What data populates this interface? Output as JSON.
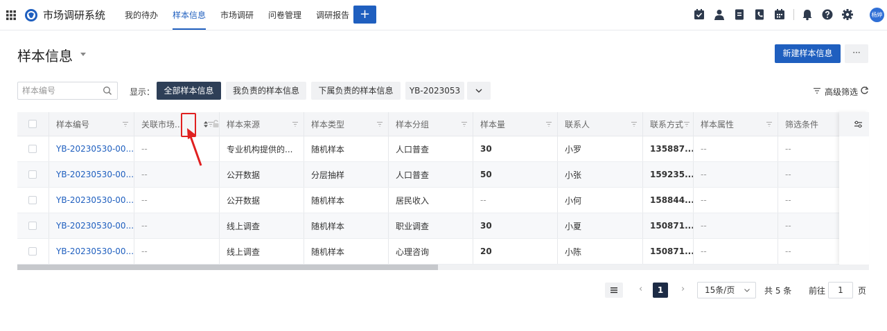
{
  "app": {
    "title": "市场调研系统"
  },
  "nav": {
    "items": [
      {
        "label": "我的待办",
        "active": false
      },
      {
        "label": "样本信息",
        "active": true
      },
      {
        "label": "市场调研",
        "active": false
      },
      {
        "label": "问卷管理",
        "active": false
      },
      {
        "label": "调研报告",
        "active": false
      }
    ],
    "plus_label": "+"
  },
  "toolbar": {
    "icons": [
      "check-square-icon",
      "user-icon",
      "document-icon",
      "phone-book-icon",
      "calendar-icon",
      "bell-icon",
      "help-icon",
      "gear-icon"
    ],
    "avatar_text": "杨婷"
  },
  "page": {
    "title": "样本信息",
    "new_button": "新建样本信息",
    "more_button": "···"
  },
  "filters": {
    "search_placeholder": "样本编号",
    "show_label": "显示：",
    "chips": [
      {
        "label": "全部样本信息",
        "active": true
      },
      {
        "label": "我负责的样本信息",
        "active": false
      },
      {
        "label": "下属负责的样本信息",
        "active": false
      },
      {
        "label": "YB-2023053",
        "active": false
      }
    ],
    "advanced": "高级筛选"
  },
  "table": {
    "columns": [
      "样本编号",
      "关联市场...",
      "样本来源",
      "样本类型",
      "样本分组",
      "样本量",
      "联系人",
      "联系方式",
      "样本属性",
      "筛选条件"
    ],
    "rows": [
      [
        "YB-20230530-00...",
        "--",
        "专业机构提供的...",
        "随机样本",
        "人口普查",
        "30",
        "小罗",
        "135887...",
        "--",
        "--"
      ],
      [
        "YB-20230530-00...",
        "--",
        "公开数据",
        "分层抽样",
        "人口普查",
        "50",
        "小张",
        "159235...",
        "--",
        "--"
      ],
      [
        "YB-20230530-00...",
        "--",
        "公开数据",
        "随机样本",
        "居民收入",
        "--",
        "小何",
        "158844...",
        "--",
        "--"
      ],
      [
        "YB-20230530-00...",
        "--",
        "线上调查",
        "随机样本",
        "职业调查",
        "30",
        "小夏",
        "150871...",
        "--",
        "--"
      ],
      [
        "YB-20230530-00...",
        "--",
        "线上调查",
        "随机样本",
        "心理咨询",
        "20",
        "小陈",
        "150871...",
        "--",
        "--"
      ]
    ]
  },
  "pagination": {
    "current": "1",
    "page_size": "15条/页",
    "total": "共 5 条",
    "goto_label": "前往",
    "goto_value": "1",
    "page_suffix": "页",
    "prev": "‹",
    "next": "›"
  },
  "colors": {
    "accent": "#1f5fbf",
    "active_chip": "#2e3f57",
    "highlight": "#e02020"
  }
}
